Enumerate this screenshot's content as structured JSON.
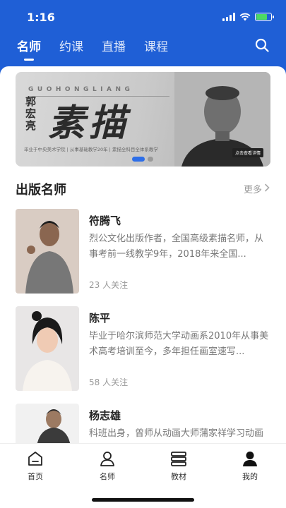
{
  "status": {
    "time": "1:16"
  },
  "tabs": [
    {
      "label": "名师"
    },
    {
      "label": "约课"
    },
    {
      "label": "直播"
    },
    {
      "label": "课程"
    }
  ],
  "banner": {
    "english": "GUOHONGLIANG",
    "name": "郭宏亮",
    "headline": "素描",
    "subtitle": "毕业于中央美术学院 | 从事基础教学20年 | 素描全科目全体系教学",
    "cta": "点击查看详情"
  },
  "section": {
    "title": "出版名师",
    "more": "更多"
  },
  "teachers": [
    {
      "name": "符腾飞",
      "desc": "烈公文化出版作者，全国高级素描名师，从事考前一线教学9年，2018年来全国...",
      "followers": "23 人关注"
    },
    {
      "name": "陈平",
      "desc": "毕业于哈尔滨师范大学动画系2010年从事美术高考培训至今，多年担任画室速写...",
      "followers": "58 人关注"
    },
    {
      "name": "杨志雄",
      "desc": "科班出身，曾师从动画大师蒲家祥学习动画设计...",
      "followers": ""
    }
  ],
  "tabbar": [
    {
      "label": "首页",
      "icon": "home-icon"
    },
    {
      "label": "名师",
      "icon": "teacher-icon"
    },
    {
      "label": "教材",
      "icon": "books-icon"
    },
    {
      "label": "我的",
      "icon": "profile-icon"
    }
  ],
  "colors": {
    "brand": "#1f5fd6",
    "accent": "#2d6ee8"
  }
}
